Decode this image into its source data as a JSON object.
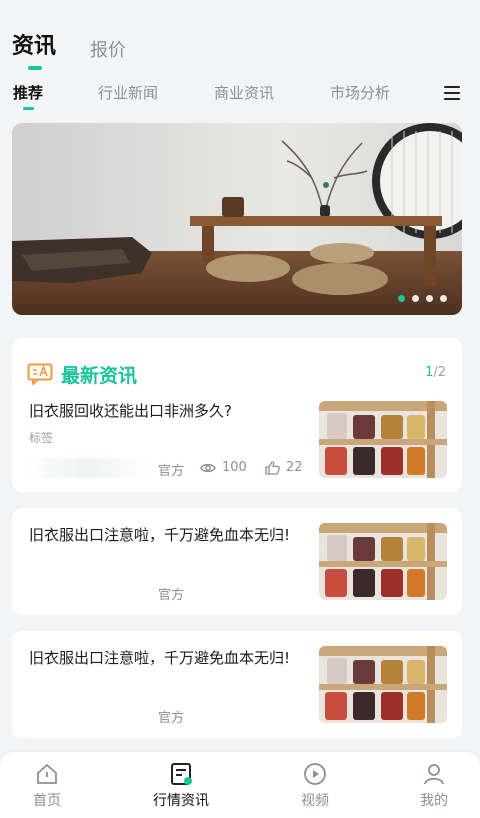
{
  "top_tabs": [
    {
      "label": "资讯"
    },
    {
      "label": "报价"
    }
  ],
  "sub_tabs": [
    {
      "label": "推荐"
    },
    {
      "label": "行业新闻"
    },
    {
      "label": "商业资讯"
    },
    {
      "label": "市场分析"
    }
  ],
  "banner": {
    "slides_total": 4,
    "active_slide": 1
  },
  "latest_news": {
    "title": "最新资讯",
    "page_current": "1",
    "page_total": "/2",
    "item": {
      "title": "旧衣服回收还能出口非洲多久?",
      "tag": "标签",
      "source": "官方",
      "views": "100",
      "likes": "22"
    }
  },
  "articles": [
    {
      "title": "旧衣服出口注意啦，千万避免血本无归!",
      "source": "官方"
    },
    {
      "title": "旧衣服出口注意啦，千万避免血本无归!",
      "source": "官方"
    }
  ],
  "tabbar": [
    {
      "label": "首页",
      "icon": "home-icon"
    },
    {
      "label": "行情资讯",
      "icon": "news-icon"
    },
    {
      "label": "视频",
      "icon": "video-icon"
    },
    {
      "label": "我的",
      "icon": "user-icon"
    }
  ],
  "colors": {
    "accent": "#18c49a",
    "news_icon": "#f39a3c"
  }
}
